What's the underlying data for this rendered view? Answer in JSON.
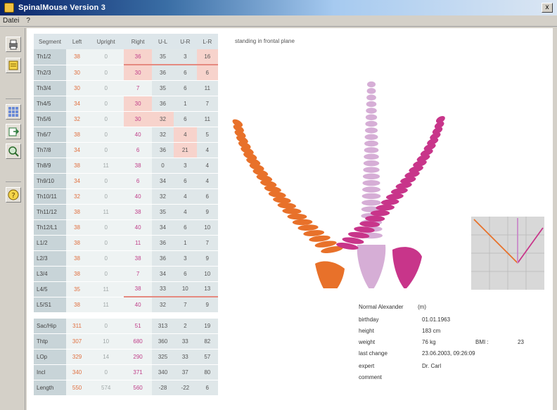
{
  "window": {
    "title": "SpinalMouse Version 3",
    "close_glyph": "x"
  },
  "menu": {
    "items": [
      "Datei",
      "?"
    ]
  },
  "toolbar": {
    "icons": [
      "print-icon",
      "notes-icon",
      "grid-icon",
      "export-icon",
      "search-icon",
      "help-icon"
    ]
  },
  "view": {
    "plane_label": "standing in frontal plane"
  },
  "table": {
    "headers": [
      "Segment",
      "Left",
      "Upright",
      "Right",
      "U-L",
      "U-R",
      "L-R"
    ],
    "rows": [
      {
        "seg": "Th1/2",
        "v": [
          "38",
          "0",
          "36",
          "35",
          "3",
          "16"
        ]
      },
      {
        "seg": "Th2/3",
        "v": [
          "30",
          "0",
          "30",
          "36",
          "6",
          "6"
        ]
      },
      {
        "seg": "Th3/4",
        "v": [
          "30",
          "0",
          "7",
          "35",
          "6",
          "11"
        ]
      },
      {
        "seg": "Th4/5",
        "v": [
          "34",
          "0",
          "30",
          "36",
          "1",
          "7"
        ]
      },
      {
        "seg": "Th5/6",
        "v": [
          "32",
          "0",
          "30",
          "32",
          "6",
          "11"
        ]
      },
      {
        "seg": "Th6/7",
        "v": [
          "38",
          "0",
          "40",
          "32",
          "4",
          "5"
        ]
      },
      {
        "seg": "Th7/8",
        "v": [
          "34",
          "0",
          "6",
          "36",
          "21",
          "4"
        ]
      },
      {
        "seg": "Th8/9",
        "v": [
          "38",
          "11",
          "38",
          "0",
          "3",
          "4"
        ]
      },
      {
        "seg": "Th9/10",
        "v": [
          "34",
          "0",
          "6",
          "34",
          "6",
          "4"
        ]
      },
      {
        "seg": "Th10/11",
        "v": [
          "32",
          "0",
          "40",
          "32",
          "4",
          "6"
        ]
      },
      {
        "seg": "Th11/12",
        "v": [
          "38",
          "11",
          "38",
          "35",
          "4",
          "9"
        ]
      },
      {
        "seg": "Th12/L1",
        "v": [
          "38",
          "0",
          "40",
          "34",
          "6",
          "10"
        ]
      },
      {
        "seg": "L1/2",
        "v": [
          "38",
          "0",
          "11",
          "36",
          "1",
          "7"
        ]
      },
      {
        "seg": "L2/3",
        "v": [
          "38",
          "0",
          "38",
          "36",
          "3",
          "9"
        ]
      },
      {
        "seg": "L3/4",
        "v": [
          "38",
          "0",
          "7",
          "34",
          "6",
          "10"
        ]
      },
      {
        "seg": "L4/5",
        "v": [
          "35",
          "11",
          "38",
          "33",
          "10",
          "13"
        ]
      },
      {
        "seg": "L5/S1",
        "v": [
          "38",
          "11",
          "40",
          "32",
          "7",
          "9"
        ]
      }
    ],
    "summary": [
      {
        "seg": "Sac/Hip",
        "v": [
          "311",
          "0",
          "51",
          "313",
          "2",
          "19"
        ]
      },
      {
        "seg": "Thtp",
        "v": [
          "307",
          "10",
          "680",
          "360",
          "33",
          "82"
        ]
      },
      {
        "seg": "LOp",
        "v": [
          "329",
          "14",
          "290",
          "325",
          "33",
          "57"
        ]
      },
      {
        "seg": "Incl",
        "v": [
          "340",
          "0",
          "371",
          "340",
          "37",
          "80"
        ]
      },
      {
        "seg": "Length",
        "v": [
          "550",
          "574",
          "560",
          "-28",
          "-22",
          "6"
        ]
      }
    ]
  },
  "patient": {
    "name": "Normal Alexander",
    "name_suffix": "(m)",
    "fields": [
      {
        "label": "birthday",
        "value": "01.01.1963"
      },
      {
        "label": "height",
        "value": "183 cm"
      },
      {
        "label": "weight",
        "value": "76 kg",
        "extra_label": "BMI :",
        "extra_value": "23"
      },
      {
        "label": "last change",
        "value": "23.06.2003, 09:26:09"
      },
      {
        "label": "expert",
        "value": "Dr. Carl"
      },
      {
        "label": "comment",
        "value": ""
      }
    ]
  },
  "colors": {
    "left_spine": "#e8712a",
    "upright_spine": "#d6aed6",
    "right_spine": "#c8358a",
    "highlight": "#f7d3cc",
    "redline": "#e58a80"
  }
}
